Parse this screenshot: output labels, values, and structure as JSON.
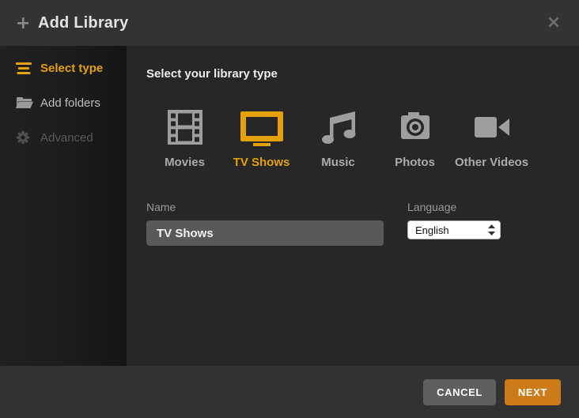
{
  "dialog": {
    "title": "Add Library"
  },
  "sidebar": {
    "items": [
      {
        "label": "Select type",
        "icon": "list-icon",
        "state": "active"
      },
      {
        "label": "Add folders",
        "icon": "folder-icon",
        "state": "normal"
      },
      {
        "label": "Advanced",
        "icon": "gear-icon",
        "state": "disabled"
      }
    ]
  },
  "main": {
    "heading": "Select your library type",
    "types": [
      {
        "label": "Movies",
        "icon": "film-strip-icon",
        "selected": false
      },
      {
        "label": "TV Shows",
        "icon": "tv-icon",
        "selected": true
      },
      {
        "label": "Music",
        "icon": "music-note-icon",
        "selected": false
      },
      {
        "label": "Photos",
        "icon": "camera-icon",
        "selected": false
      },
      {
        "label": "Other Videos",
        "icon": "video-camera-icon",
        "selected": false
      }
    ],
    "name_field": {
      "label": "Name",
      "value": "TV Shows"
    },
    "language_field": {
      "label": "Language",
      "value": "English"
    }
  },
  "footer": {
    "cancel_label": "CANCEL",
    "next_label": "NEXT"
  },
  "colors": {
    "accent_gold": "#e5a00d",
    "accent_orange": "#cc7b19",
    "icon_gray": "#9e9e9e"
  }
}
